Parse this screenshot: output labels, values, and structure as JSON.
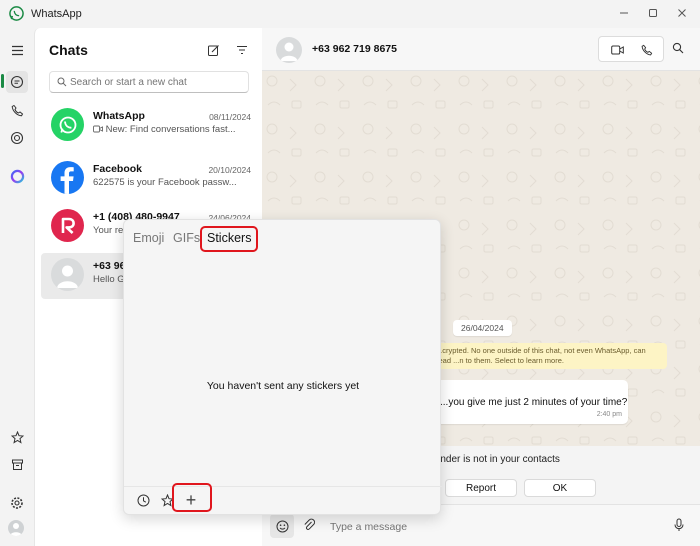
{
  "app": {
    "title": "WhatsApp",
    "accent": "#1a8a44"
  },
  "window_controls": [
    "minimize-icon",
    "maximize-icon",
    "close-icon"
  ],
  "rail": {
    "top_items": [
      "menu-icon",
      "chats-icon",
      "calls-icon",
      "status-icon",
      "meta-ai-icon"
    ],
    "bottom_items": [
      "starred-icon",
      "archived-icon",
      "settings-icon",
      "profile-avatar"
    ]
  },
  "chatlist": {
    "title": "Chats",
    "search_placeholder": "Search or start a new chat",
    "chats": [
      {
        "name": "WhatsApp",
        "date": "08/11/2024",
        "preview": "New: Find conversations fast...",
        "avatar": "whatsapp-logo",
        "color": "#25d366"
      },
      {
        "name": "Facebook",
        "date": "20/10/2024",
        "preview": "622575 is your Facebook passw...",
        "avatar": "facebook-logo",
        "color": "#1877f2"
      },
      {
        "name": "+1 (408) 480-9947",
        "date": "24/06/2024",
        "preview": "Your re...",
        "avatar": "red-r-logo",
        "color": "#e0264e"
      },
      {
        "name": "+63 96...",
        "date": "",
        "preview": "Hello G...",
        "avatar": "default-avatar",
        "color": "#d9dbdc"
      }
    ]
  },
  "conversation": {
    "contact": "+63 962 719 8675",
    "date_chip": "26/04/2024",
    "encryption_notice": "...crypted. No one outside of this chat, not even WhatsApp, can read ...n to them. Select to learn more.",
    "message": {
      "text": "...you give me just 2 minutes of your time?",
      "time": "2:40 pm"
    },
    "unknown_sender_text": "...nder is not in your contacts",
    "report_label": "Report",
    "ok_label": "OK",
    "composer_placeholder": "Type a message"
  },
  "sticker_popup": {
    "tabs": [
      "Emoji",
      "GIFs",
      "Stickers"
    ],
    "active_tab": "Stickers",
    "empty_text": "You haven't sent any stickers yet",
    "footer_icons": [
      "recent-icon",
      "favorites-icon",
      "add-sticker-icon"
    ],
    "highlight_color": "#e0161d"
  }
}
